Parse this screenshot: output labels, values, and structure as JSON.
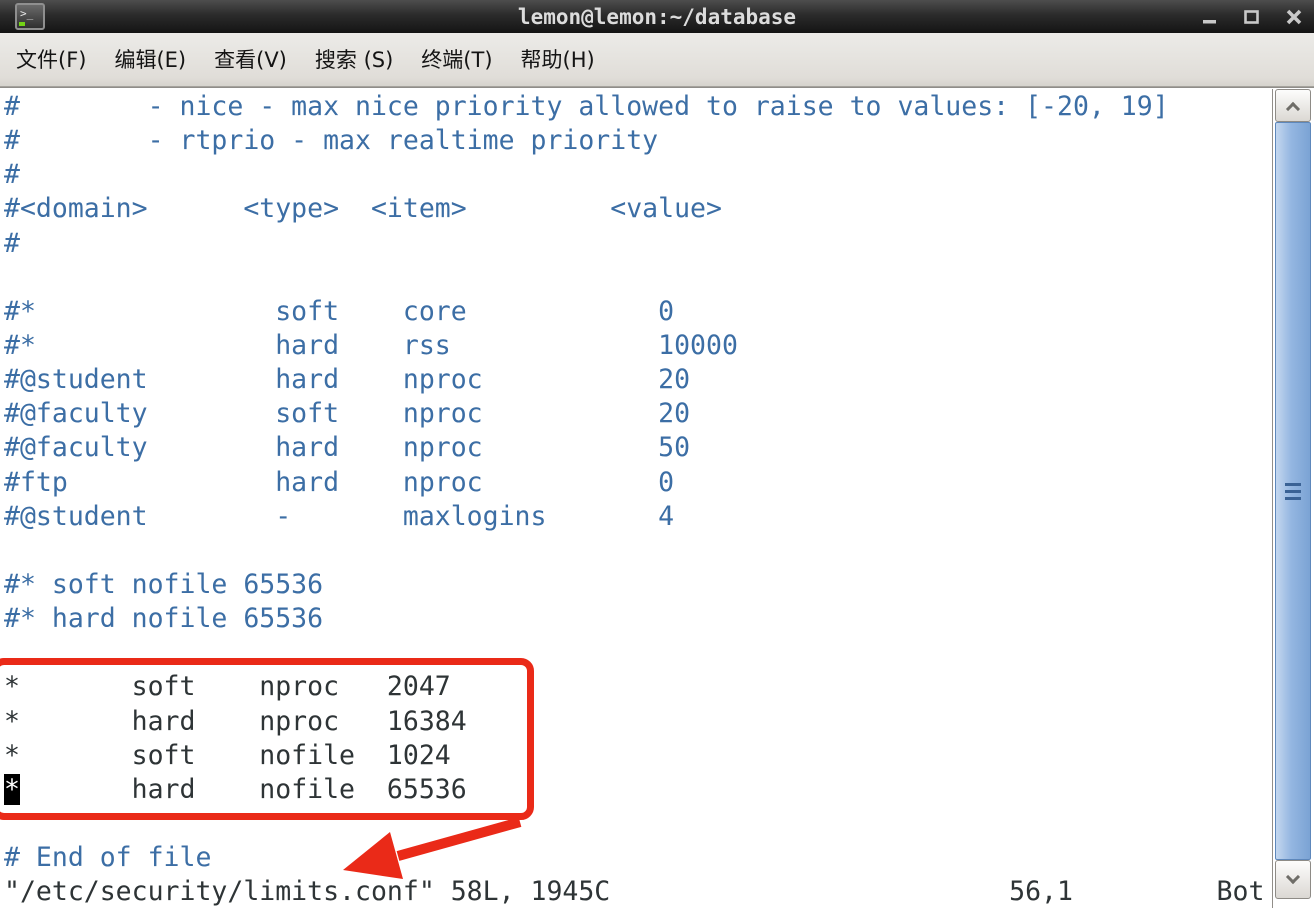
{
  "window": {
    "title": "lemon@lemon:~/database",
    "controls": [
      {
        "icon": "minimize-icon"
      },
      {
        "icon": "maximize-icon"
      },
      {
        "icon": "close-icon"
      }
    ]
  },
  "menu": {
    "items": [
      {
        "label": "文件(F)"
      },
      {
        "label": "编辑(E)"
      },
      {
        "label": "查看(V)"
      },
      {
        "label": "搜索 (S)"
      },
      {
        "label": "终端(T)"
      },
      {
        "label": "帮助(H)"
      }
    ]
  },
  "terminal": {
    "colors": {
      "comment": "#3c6ea5",
      "text": "#2e3436",
      "background": "#ffffff",
      "cursor_bg": "#000000",
      "cursor_fg": "#ffffff",
      "annotation_red": "#ea2a18"
    },
    "rows": [
      {
        "text": "#        - nice - max nice priority allowed to raise to values: [-20, 19]",
        "style": "comment"
      },
      {
        "text": "#        - rtprio - max realtime priority",
        "style": "comment"
      },
      {
        "text": "#",
        "style": "comment"
      },
      {
        "text": "#<domain>      <type>  <item>         <value>",
        "style": "comment"
      },
      {
        "text": "#",
        "style": "comment"
      },
      {
        "text": "",
        "style": "comment"
      },
      {
        "text": "#*               soft    core            0",
        "style": "comment"
      },
      {
        "text": "#*               hard    rss             10000",
        "style": "comment"
      },
      {
        "text": "#@student        hard    nproc           20",
        "style": "comment"
      },
      {
        "text": "#@faculty        soft    nproc           20",
        "style": "comment"
      },
      {
        "text": "#@faculty        hard    nproc           50",
        "style": "comment"
      },
      {
        "text": "#ftp             hard    nproc           0",
        "style": "comment"
      },
      {
        "text": "#@student        -       maxlogins       4",
        "style": "comment"
      },
      {
        "text": "",
        "style": "comment"
      },
      {
        "text": "#* soft nofile 65536",
        "style": "comment"
      },
      {
        "text": "#* hard nofile 65536",
        "style": "comment"
      },
      {
        "text": "",
        "style": "comment"
      },
      {
        "text": "*       soft    nproc   2047",
        "style": "plain"
      },
      {
        "text": "*       hard    nproc   16384",
        "style": "plain"
      },
      {
        "text": "*       soft    nofile  1024",
        "style": "plain"
      },
      {
        "text": "*       hard    nofile  65536",
        "style": "plain",
        "cursor_col": 0
      },
      {
        "text": "",
        "style": "plain"
      },
      {
        "text": "# End of file",
        "style": "comment"
      },
      {
        "text": "\"/etc/security/limits.conf\" 58L, 1945C                         56,1         Bot",
        "style": "plain"
      }
    ],
    "status": {
      "file_info": "\"/etc/security/limits.conf\" 58L, 1945C",
      "ruler": "56,1",
      "scroll_position": "Bot"
    }
  },
  "scrollbar": {
    "up_icon": "chevron-up-icon",
    "down_icon": "chevron-down-icon"
  },
  "annotations": {
    "box_highlights": [
      "* soft nproc 2047",
      "* hard nproc 16384",
      "* soft nofile 1024",
      "* hard nofile 65536"
    ],
    "arrow_points_to": "limits.conf"
  }
}
